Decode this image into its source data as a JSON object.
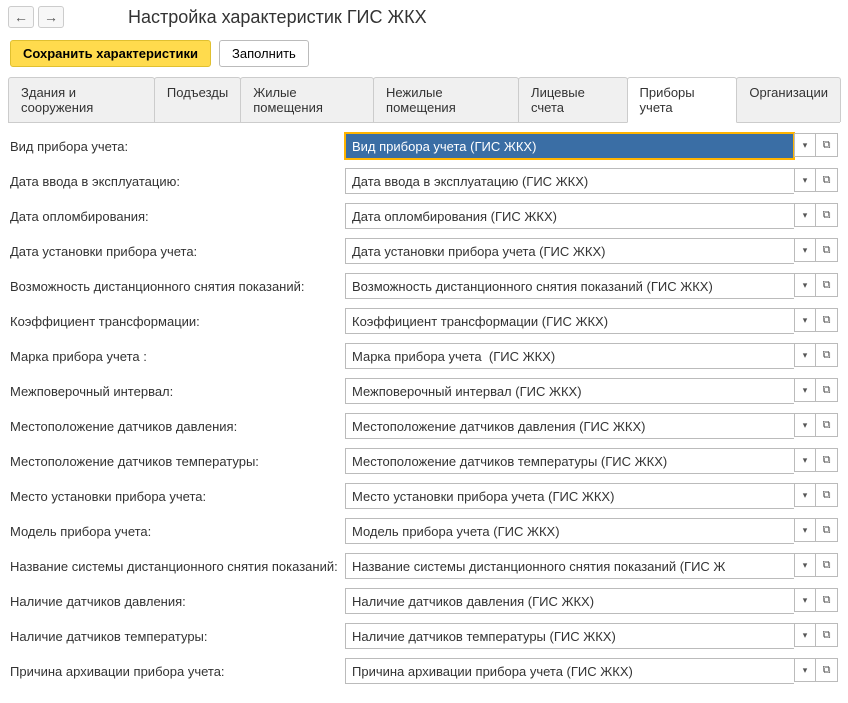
{
  "header": {
    "title": "Настройка характеристик ГИС ЖКХ"
  },
  "actions": {
    "save": "Сохранить характеристики",
    "fill": "Заполнить"
  },
  "tabs": [
    {
      "label": "Здания и сооружения",
      "active": false
    },
    {
      "label": "Подъезды",
      "active": false
    },
    {
      "label": "Жилые помещения",
      "active": false
    },
    {
      "label": "Нежилые помещения",
      "active": false
    },
    {
      "label": "Лицевые счета",
      "active": false
    },
    {
      "label": "Приборы учета",
      "active": true
    },
    {
      "label": "Организации",
      "active": false
    }
  ],
  "fields": [
    {
      "label": "Вид прибора учета:",
      "value": "Вид прибора учета (ГИС ЖКХ)",
      "focused": true
    },
    {
      "label": "Дата ввода в эксплуатацию:",
      "value": "Дата ввода в эксплуатацию (ГИС ЖКХ)"
    },
    {
      "label": "Дата опломбирования:",
      "value": "Дата опломбирования (ГИС ЖКХ)"
    },
    {
      "label": "Дата установки прибора учета:",
      "value": "Дата установки прибора учета (ГИС ЖКХ)"
    },
    {
      "label": "Возможность дистанционного снятия показаний:",
      "value": "Возможность дистанционного снятия показаний (ГИС ЖКХ)"
    },
    {
      "label": "Коэффициент трансформации:",
      "value": "Коэффициент трансформации (ГИС ЖКХ)"
    },
    {
      "label": "Марка прибора учета :",
      "value": "Марка прибора учета  (ГИС ЖКХ)"
    },
    {
      "label": "Межповерочный интервал:",
      "value": "Межповерочный интервал (ГИС ЖКХ)"
    },
    {
      "label": "Местоположение датчиков давления:",
      "value": "Местоположение датчиков давления (ГИС ЖКХ)"
    },
    {
      "label": "Местоположение датчиков температуры:",
      "value": "Местоположение датчиков температуры (ГИС ЖКХ)"
    },
    {
      "label": "Место установки прибора учета:",
      "value": "Место установки прибора учета (ГИС ЖКХ)"
    },
    {
      "label": "Модель прибора учета:",
      "value": "Модель прибора учета (ГИС ЖКХ)"
    },
    {
      "label": "Название системы дистанционного снятия показаний:",
      "value": "Название системы дистанционного снятия показаний (ГИС Ж"
    },
    {
      "label": "Наличие датчиков давления:",
      "value": "Наличие датчиков давления (ГИС ЖКХ)"
    },
    {
      "label": "Наличие датчиков температуры:",
      "value": "Наличие датчиков температуры (ГИС ЖКХ)"
    },
    {
      "label": "Причина архивации прибора учета:",
      "value": "Причина архивации прибора учета (ГИС ЖКХ)"
    }
  ]
}
